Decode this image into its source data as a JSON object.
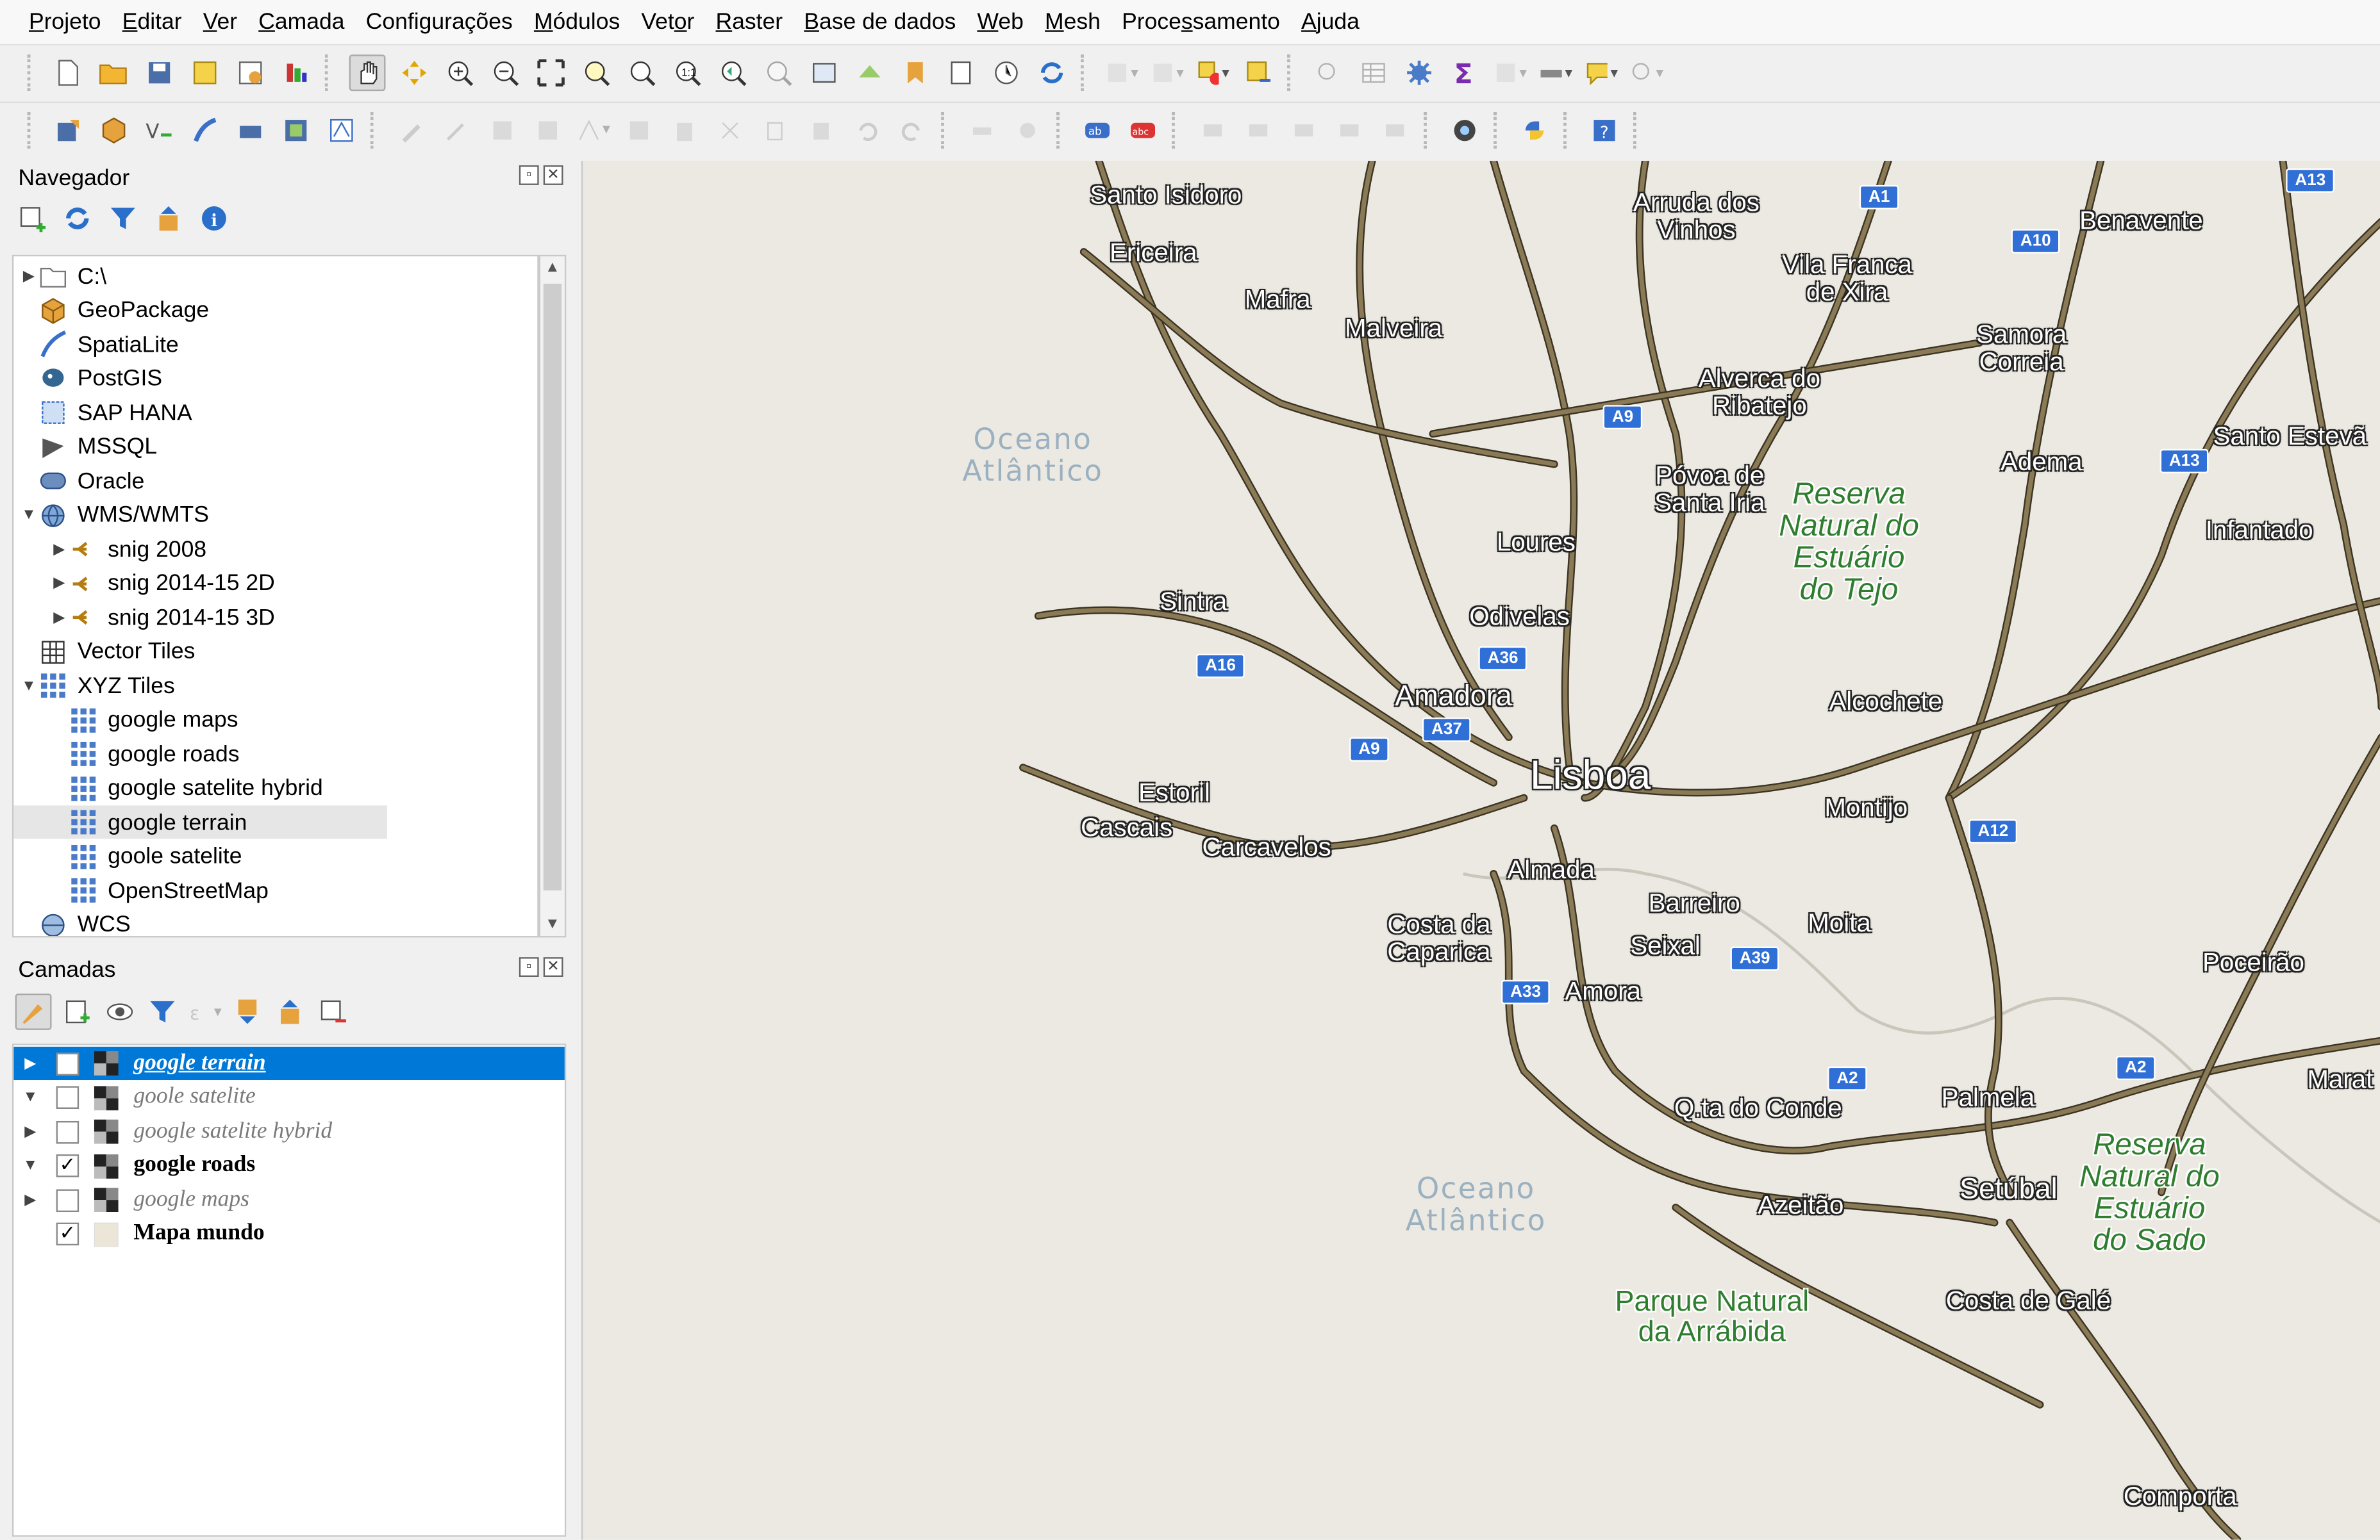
{
  "menu": [
    {
      "id": "projeto",
      "pre": "",
      "u": "P",
      "post": "rojeto"
    },
    {
      "id": "editar",
      "pre": "",
      "u": "E",
      "post": "ditar"
    },
    {
      "id": "ver",
      "pre": "",
      "u": "V",
      "post": "er"
    },
    {
      "id": "camada",
      "pre": "",
      "u": "C",
      "post": "amada"
    },
    {
      "id": "configuracoes",
      "pre": "Confi",
      "u": "g",
      "post": "urações"
    },
    {
      "id": "modulos",
      "pre": "",
      "u": "M",
      "post": "ódulos"
    },
    {
      "id": "vetor",
      "pre": "Vet",
      "u": "o",
      "post": "r"
    },
    {
      "id": "raster",
      "pre": "",
      "u": "R",
      "post": "aster"
    },
    {
      "id": "base-de-dados",
      "pre": "",
      "u": "B",
      "post": "ase de dados"
    },
    {
      "id": "web",
      "pre": "",
      "u": "W",
      "post": "eb"
    },
    {
      "id": "mesh",
      "pre": "",
      "u": "M",
      "post": "esh"
    },
    {
      "id": "processamento",
      "pre": "Proce",
      "u": "s",
      "post": "samento"
    },
    {
      "id": "ajuda",
      "pre": "",
      "u": "A",
      "post": "juda"
    }
  ],
  "browser": {
    "title": "Navegador",
    "items": [
      {
        "label": "C:\\",
        "icon": "folder-icon",
        "twisty": "collapsed",
        "indent": 0
      },
      {
        "label": "GeoPackage",
        "icon": "geopackage-icon",
        "twisty": "",
        "indent": 0
      },
      {
        "label": "SpatiaLite",
        "icon": "spatialite-icon",
        "twisty": "",
        "indent": 0
      },
      {
        "label": "PostGIS",
        "icon": "postgis-icon",
        "twisty": "",
        "indent": 0
      },
      {
        "label": "SAP HANA",
        "icon": "saphana-icon",
        "twisty": "",
        "indent": 0
      },
      {
        "label": "MSSQL",
        "icon": "mssql-icon",
        "twisty": "",
        "indent": 0
      },
      {
        "label": "Oracle",
        "icon": "oracle-icon",
        "twisty": "",
        "indent": 0
      },
      {
        "label": "WMS/WMTS",
        "icon": "globe-icon",
        "twisty": "expanded",
        "indent": 0
      },
      {
        "label": "snig 2008",
        "icon": "wms-connection-icon",
        "twisty": "collapsed",
        "indent": 1
      },
      {
        "label": "snig 2014-15 2D",
        "icon": "wms-connection-icon",
        "twisty": "collapsed",
        "indent": 1
      },
      {
        "label": "snig 2014-15 3D",
        "icon": "wms-connection-icon",
        "twisty": "collapsed",
        "indent": 1
      },
      {
        "label": "Vector Tiles",
        "icon": "vector-tiles-icon",
        "twisty": "",
        "indent": 0
      },
      {
        "label": "XYZ Tiles",
        "icon": "xyz-tiles-icon",
        "twisty": "expanded",
        "indent": 0
      },
      {
        "label": "google maps",
        "icon": "xyz-tiles-icon",
        "twisty": "",
        "indent": 1
      },
      {
        "label": "google roads",
        "icon": "xyz-tiles-icon",
        "twisty": "",
        "indent": 1
      },
      {
        "label": "google satelite hybrid",
        "icon": "xyz-tiles-icon",
        "twisty": "",
        "indent": 1
      },
      {
        "label": "google terrain",
        "icon": "xyz-tiles-icon",
        "twisty": "",
        "indent": 1,
        "selected": true
      },
      {
        "label": "goole satelite",
        "icon": "xyz-tiles-icon",
        "twisty": "",
        "indent": 1
      },
      {
        "label": "OpenStreetMap",
        "icon": "xyz-tiles-icon",
        "twisty": "",
        "indent": 1
      },
      {
        "label": "WCS",
        "icon": "wcs-globe-icon",
        "twisty": "",
        "indent": 0
      }
    ]
  },
  "layers": {
    "title": "Camadas",
    "items": [
      {
        "name": "google terrain",
        "checked": false,
        "twisty": "collapsed",
        "state": "selected"
      },
      {
        "name": "goole satelite",
        "checked": false,
        "twisty": "expanded",
        "state": "off"
      },
      {
        "name": "google satelite hybrid",
        "checked": false,
        "twisty": "collapsed",
        "state": "off"
      },
      {
        "name": "google roads",
        "checked": true,
        "twisty": "expanded",
        "state": "on"
      },
      {
        "name": "google maps",
        "checked": false,
        "twisty": "collapsed",
        "state": "off"
      },
      {
        "name": "Mapa mundo",
        "checked": true,
        "twisty": "",
        "state": "on"
      }
    ]
  },
  "map": {
    "labels": {
      "santo_isidoro": "Santo Isidoro",
      "ericeira": "Ericeira",
      "mafra": "Mafra",
      "malveira": "Malveira",
      "arruda1": "Arruda dos",
      "arruda2": "Vinhos",
      "vila_franca1": "Vila Franca",
      "vila_franca2": "de Xira",
      "benavente": "Benavente",
      "samora1": "Samora",
      "samora2": "Correia",
      "alverca1": "Alverca do",
      "alverca2": "Ribatejo",
      "povoa1": "Póvoa de",
      "povoa2": "Santa Iria",
      "adema": "Adema",
      "santo_esteva": "Santo Estevã",
      "infantado": "Infantado",
      "loures": "Loures",
      "sintra": "Sintra",
      "odivelas": "Odivelas",
      "amadora": "Amadora",
      "lisboa": "Lisboa",
      "alcochete": "Alcochete",
      "montijo": "Montijo",
      "estoril": "Estoril",
      "cascais": "Cascais",
      "carcavelos": "Carcavelos",
      "almada": "Almada",
      "barreiro": "Barreiro",
      "moita": "Moita",
      "costa1": "Costa da",
      "costa2": "Caparica",
      "seixal": "Seixal",
      "amora": "Amora",
      "poceirao": "Poceirão",
      "qta_conde": "Q.ta do Conde",
      "palmela": "Palmela",
      "marat": "Marat",
      "azeitao": "Azeitão",
      "setubal": "Setúbal",
      "costa_gale": "Costa de Galé",
      "comporta": "Comporta"
    },
    "green": {
      "reserva_tejo1": "Reserva",
      "reserva_tejo2": "Natural do",
      "reserva_tejo3": "Estuário",
      "reserva_tejo4": "do Tejo",
      "reserva_sado1": "Reserva",
      "reserva_sado2": "Natural do",
      "reserva_sado3": "Estuário",
      "reserva_sado4": "do Sado",
      "arrabida1": "Parque Natural",
      "arrabida2": "da Arrábida"
    },
    "ocean": {
      "a1": "Oceano",
      "a2": "Atlântico",
      "b1": "Oceano",
      "b2": "Atlântico"
    },
    "shields": {
      "a13a": "A13",
      "a1": "A1",
      "a10": "A10",
      "a9a": "A9",
      "a13b": "A13",
      "a16": "A16",
      "a36": "A36",
      "a37": "A37",
      "a9b": "A9",
      "a12": "A12",
      "a39": "A39",
      "a33": "A33",
      "a2a": "A2",
      "a2b": "A2"
    }
  },
  "colors": {
    "road": "#8a7a55",
    "road_outline": "#3b3323",
    "selection": "#0078d7",
    "map_bg": "#ebe9e1",
    "shield": "#2f6fd6"
  }
}
